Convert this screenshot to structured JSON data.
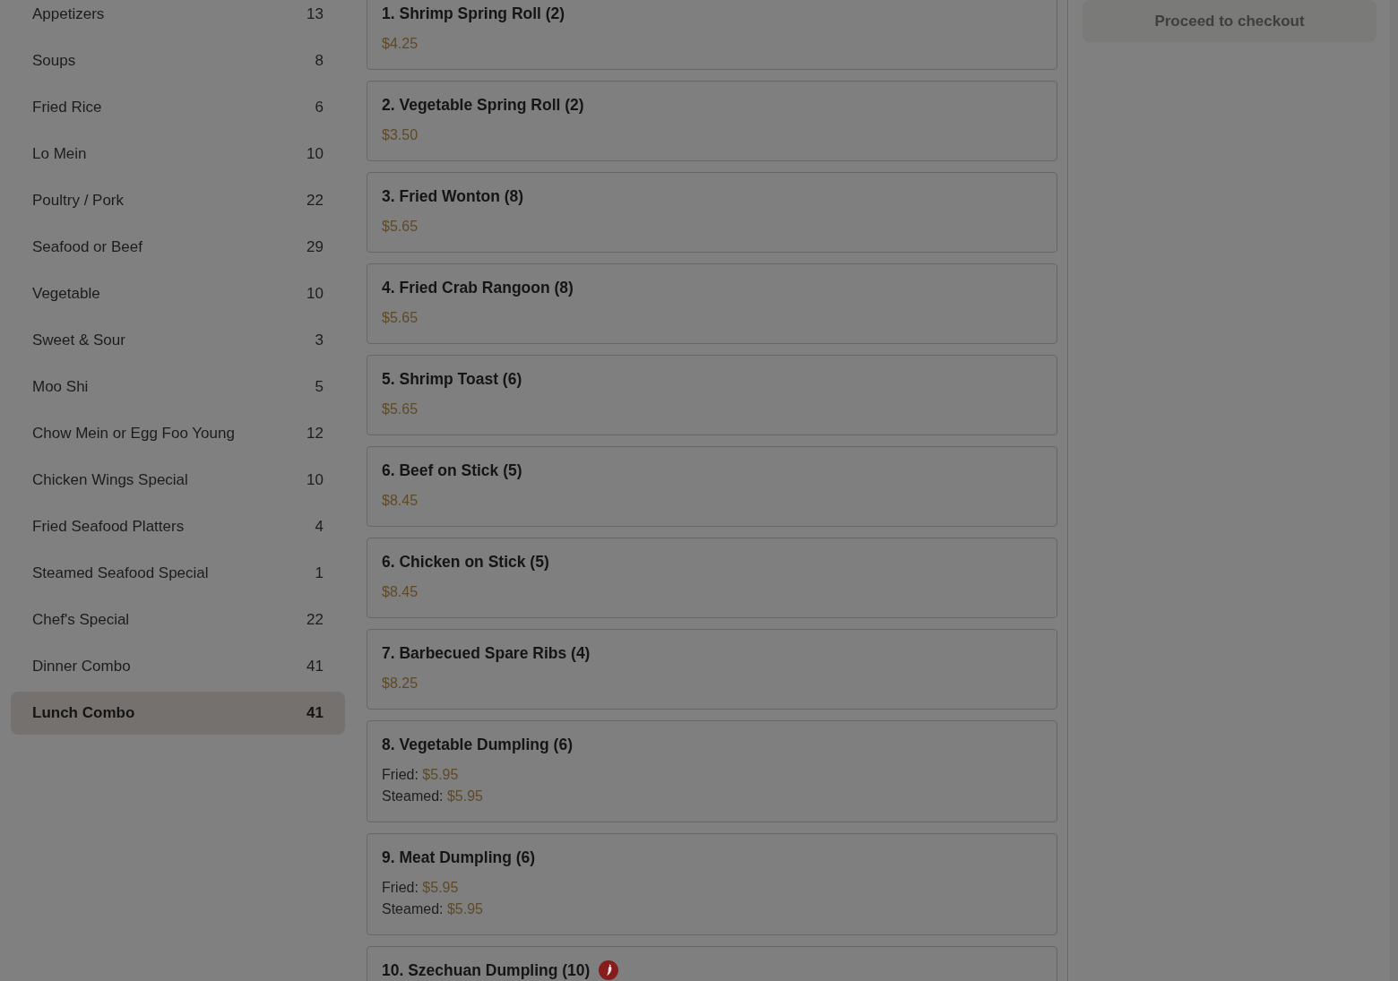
{
  "categories": [
    {
      "name": "Appetizers",
      "count": "13",
      "selected": false
    },
    {
      "name": "Soups",
      "count": "8",
      "selected": false
    },
    {
      "name": "Fried Rice",
      "count": "6",
      "selected": false
    },
    {
      "name": "Lo Mein",
      "count": "10",
      "selected": false
    },
    {
      "name": "Poultry / Pork",
      "count": "22",
      "selected": false
    },
    {
      "name": "Seafood or Beef",
      "count": "29",
      "selected": false
    },
    {
      "name": "Vegetable",
      "count": "10",
      "selected": false
    },
    {
      "name": "Sweet & Sour",
      "count": "3",
      "selected": false
    },
    {
      "name": "Moo Shi",
      "count": "5",
      "selected": false
    },
    {
      "name": "Chow Mein or Egg Foo Young",
      "count": "12",
      "selected": false
    },
    {
      "name": "Chicken Wings Special",
      "count": "10",
      "selected": false
    },
    {
      "name": "Fried Seafood Platters",
      "count": "4",
      "selected": false
    },
    {
      "name": "Steamed Seafood Special",
      "count": "1",
      "selected": false
    },
    {
      "name": "Chef's Special",
      "count": "22",
      "selected": false
    },
    {
      "name": "Dinner Combo",
      "count": "41",
      "selected": false
    },
    {
      "name": "Lunch Combo",
      "count": "41",
      "selected": true
    }
  ],
  "menu_items": [
    {
      "title": "1. Shrimp Spring Roll (2)",
      "spicy": false,
      "prices": [
        {
          "price": "$4.25"
        }
      ]
    },
    {
      "title": "2. Vegetable Spring Roll (2)",
      "spicy": false,
      "prices": [
        {
          "price": "$3.50"
        }
      ]
    },
    {
      "title": "3. Fried Wonton (8)",
      "spicy": false,
      "prices": [
        {
          "price": "$5.65"
        }
      ]
    },
    {
      "title": "4. Fried Crab Rangoon (8)",
      "spicy": false,
      "prices": [
        {
          "price": "$5.65"
        }
      ]
    },
    {
      "title": "5. Shrimp Toast (6)",
      "spicy": false,
      "prices": [
        {
          "price": "$5.65"
        }
      ]
    },
    {
      "title": "6. Beef on Stick (5)",
      "spicy": false,
      "prices": [
        {
          "price": "$8.45"
        }
      ]
    },
    {
      "title": "6. Chicken on Stick (5)",
      "spicy": false,
      "prices": [
        {
          "price": "$8.45"
        }
      ]
    },
    {
      "title": "7. Barbecued Spare Ribs (4)",
      "spicy": false,
      "prices": [
        {
          "price": "$8.25"
        }
      ]
    },
    {
      "title": "8. Vegetable Dumpling (6)",
      "spicy": false,
      "prices": [
        {
          "label": "Fried:",
          "price": "$5.95"
        },
        {
          "label": "Steamed:",
          "price": "$5.95"
        }
      ]
    },
    {
      "title": "9. Meat Dumpling (6)",
      "spicy": false,
      "prices": [
        {
          "label": "Fried:",
          "price": "$5.95"
        },
        {
          "label": "Steamed:",
          "price": "$5.95"
        }
      ]
    },
    {
      "title": "10. Szechuan Dumpling (10)",
      "spicy": true
    }
  ],
  "cart": {
    "checkout_button": {
      "label": "Proceed to checkout",
      "disabled": true
    }
  }
}
